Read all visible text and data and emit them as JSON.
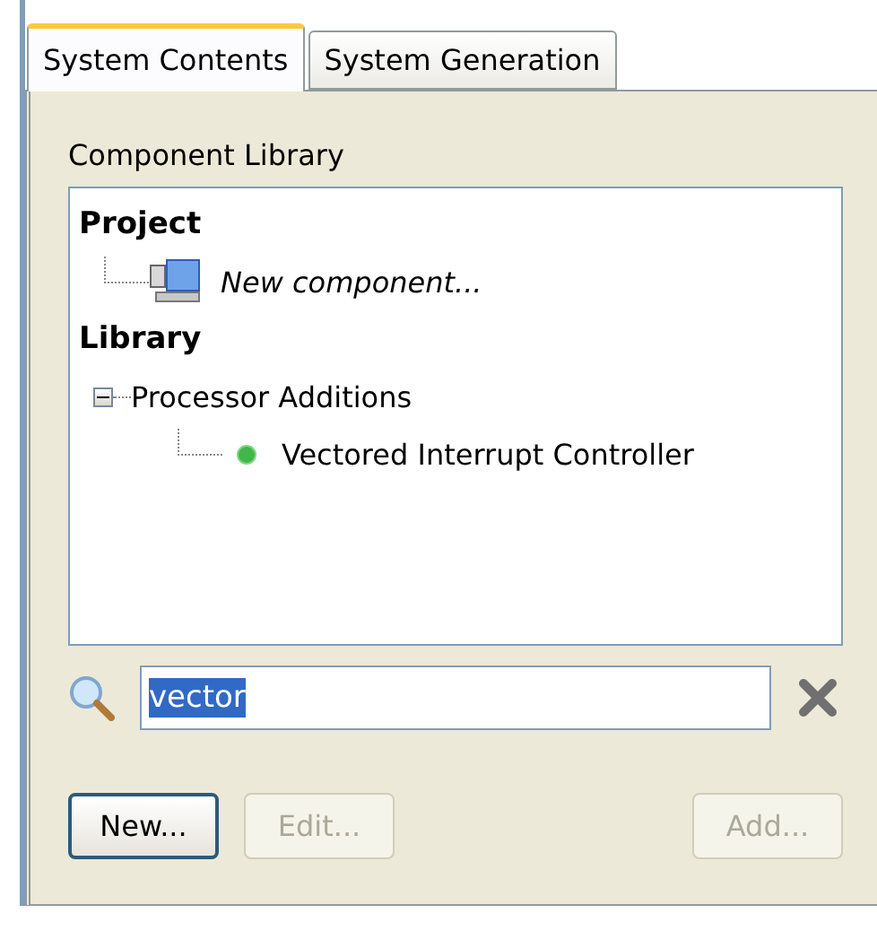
{
  "tabs": [
    {
      "label": "System Contents",
      "selected": true
    },
    {
      "label": "System Generation",
      "selected": false
    }
  ],
  "component_library": {
    "label": "Component Library",
    "tree": [
      {
        "label": "Project",
        "kind": "heading",
        "children": [
          {
            "label": "New component...",
            "kind": "new"
          }
        ]
      },
      {
        "label": "Library",
        "kind": "heading",
        "children": [
          {
            "label": "Processor Additions",
            "kind": "folder",
            "expanded": true,
            "children": [
              {
                "label": "Vectored Interrupt Controller",
                "kind": "component"
              }
            ]
          }
        ]
      }
    ]
  },
  "search": {
    "value": "vector",
    "text_selected": true
  },
  "buttons": [
    {
      "label": "New...",
      "disabled": false,
      "focused": true
    },
    {
      "label": "Edit...",
      "disabled": true,
      "focused": false
    },
    {
      "label": "Add...",
      "disabled": true,
      "focused": false
    }
  ]
}
